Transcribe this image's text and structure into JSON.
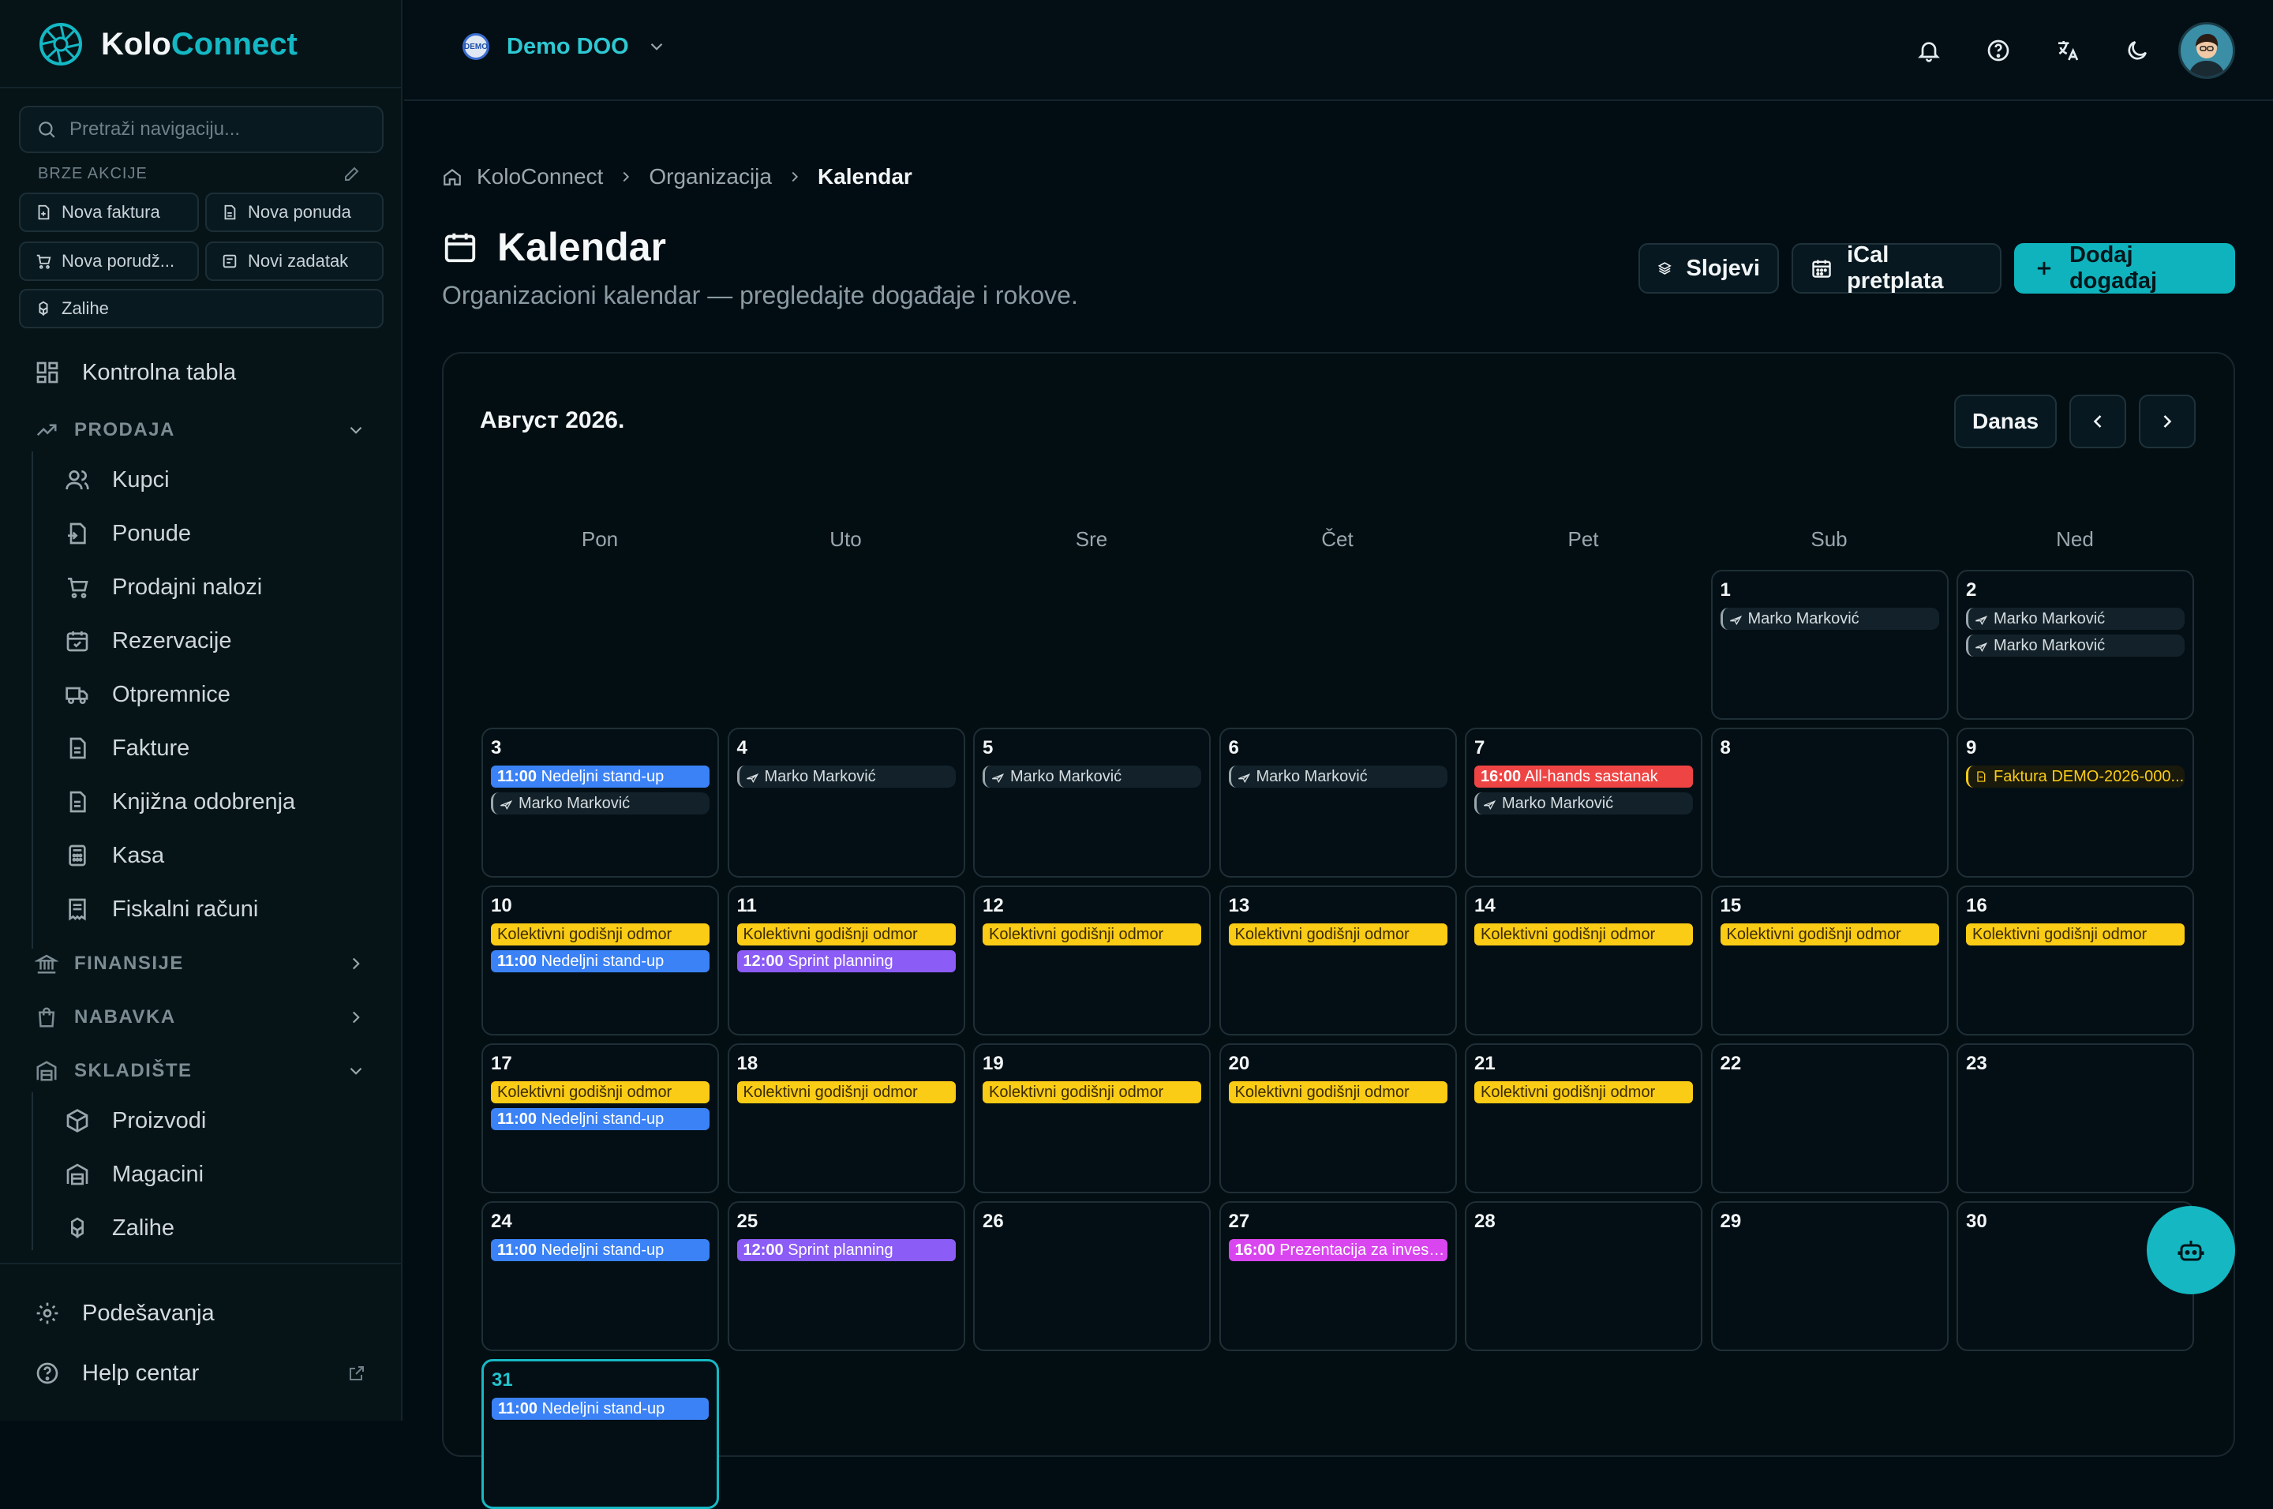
{
  "app": {
    "logo_first": "Kolo",
    "logo_second": "Connect"
  },
  "sidebar": {
    "search_placeholder": "Pretraži navigaciju...",
    "quick_actions_label": "BRZE AKCIJE",
    "quick_actions": [
      "Nova faktura",
      "Nova ponuda",
      "Nova porudž...",
      "Novi zadatak",
      "Zalihe"
    ],
    "dashboard": "Kontrolna tabla",
    "sections": {
      "prodaja": "PRODAJA",
      "finansije": "FINANSIJE",
      "nabavka": "NABAVKA",
      "skladiste": "SKLADIŠTE"
    },
    "prodaja_items": [
      "Kupci",
      "Ponude",
      "Prodajni nalozi",
      "Rezervacije",
      "Otpremnice",
      "Fakture",
      "Knjižna odobrenja",
      "Kasa",
      "Fiskalni računi"
    ],
    "skladiste_items": [
      "Proizvodi",
      "Magacini",
      "Zalihe"
    ],
    "settings": "Podešavanja",
    "help": "Help centar"
  },
  "topbar": {
    "org_badge": "DEMO",
    "org_name": "Demo DOO"
  },
  "breadcrumb": [
    "KoloConnect",
    "Organizacija",
    "Kalendar"
  ],
  "header": {
    "title": "Kalendar",
    "subtitle": "Organizacioni kalendar — pregledajte događaje i rokove.",
    "layers_btn": "Slojevi",
    "ical_btn": "iCal pretplata",
    "add_btn": "Dodaj događaj"
  },
  "calendar": {
    "month_label": "Август 2026.",
    "today_btn": "Danas",
    "weekdays": [
      "Pon",
      "Uto",
      "Sre",
      "Čet",
      "Pet",
      "Sub",
      "Ned"
    ],
    "days": [
      {
        "n": "1",
        "col": 5,
        "row": 0,
        "events": [
          {
            "t": "leave",
            "text": "Marko Marković"
          }
        ]
      },
      {
        "n": "2",
        "col": 6,
        "row": 0,
        "events": [
          {
            "t": "leave",
            "text": "Marko Marković"
          },
          {
            "t": "leave",
            "text": "Marko Marković"
          }
        ]
      },
      {
        "n": "3",
        "col": 0,
        "row": 1,
        "events": [
          {
            "t": "blue",
            "time": "11:00",
            "text": "Nedeljni stand-up"
          },
          {
            "t": "leave",
            "text": "Marko Marković"
          }
        ]
      },
      {
        "n": "4",
        "col": 1,
        "row": 1,
        "events": [
          {
            "t": "leave",
            "text": "Marko Marković"
          }
        ]
      },
      {
        "n": "5",
        "col": 2,
        "row": 1,
        "events": [
          {
            "t": "leave",
            "text": "Marko Marković"
          }
        ]
      },
      {
        "n": "6",
        "col": 3,
        "row": 1,
        "events": [
          {
            "t": "leave",
            "text": "Marko Marković"
          }
        ]
      },
      {
        "n": "7",
        "col": 4,
        "row": 1,
        "events": [
          {
            "t": "red",
            "time": "16:00",
            "text": "All-hands sastanak"
          },
          {
            "t": "leave",
            "text": "Marko Marković"
          }
        ]
      },
      {
        "n": "8",
        "col": 5,
        "row": 1,
        "events": []
      },
      {
        "n": "9",
        "col": 6,
        "row": 1,
        "events": [
          {
            "t": "invoice",
            "text": "Faktura DEMO-2026-000..."
          }
        ]
      },
      {
        "n": "10",
        "col": 0,
        "row": 2,
        "events": [
          {
            "t": "yellow",
            "text": "Kolektivni godišnji odmor"
          },
          {
            "t": "blue",
            "time": "11:00",
            "text": "Nedeljni stand-up"
          }
        ]
      },
      {
        "n": "11",
        "col": 1,
        "row": 2,
        "events": [
          {
            "t": "yellow",
            "text": "Kolektivni godišnji odmor"
          },
          {
            "t": "purple",
            "time": "12:00",
            "text": "Sprint planning"
          }
        ]
      },
      {
        "n": "12",
        "col": 2,
        "row": 2,
        "events": [
          {
            "t": "yellow",
            "text": "Kolektivni godišnji odmor"
          }
        ]
      },
      {
        "n": "13",
        "col": 3,
        "row": 2,
        "events": [
          {
            "t": "yellow",
            "text": "Kolektivni godišnji odmor"
          }
        ]
      },
      {
        "n": "14",
        "col": 4,
        "row": 2,
        "events": [
          {
            "t": "yellow",
            "text": "Kolektivni godišnji odmor"
          }
        ]
      },
      {
        "n": "15",
        "col": 5,
        "row": 2,
        "events": [
          {
            "t": "yellow",
            "text": "Kolektivni godišnji odmor"
          }
        ]
      },
      {
        "n": "16",
        "col": 6,
        "row": 2,
        "events": [
          {
            "t": "yellow",
            "text": "Kolektivni godišnji odmor"
          }
        ]
      },
      {
        "n": "17",
        "col": 0,
        "row": 3,
        "events": [
          {
            "t": "yellow",
            "text": "Kolektivni godišnji odmor"
          },
          {
            "t": "blue",
            "time": "11:00",
            "text": "Nedeljni stand-up"
          }
        ]
      },
      {
        "n": "18",
        "col": 1,
        "row": 3,
        "events": [
          {
            "t": "yellow",
            "text": "Kolektivni godišnji odmor"
          }
        ]
      },
      {
        "n": "19",
        "col": 2,
        "row": 3,
        "events": [
          {
            "t": "yellow",
            "text": "Kolektivni godišnji odmor"
          }
        ]
      },
      {
        "n": "20",
        "col": 3,
        "row": 3,
        "events": [
          {
            "t": "yellow",
            "text": "Kolektivni godišnji odmor"
          }
        ]
      },
      {
        "n": "21",
        "col": 4,
        "row": 3,
        "events": [
          {
            "t": "yellow",
            "text": "Kolektivni godišnji odmor"
          }
        ]
      },
      {
        "n": "22",
        "col": 5,
        "row": 3,
        "events": []
      },
      {
        "n": "23",
        "col": 6,
        "row": 3,
        "events": []
      },
      {
        "n": "24",
        "col": 0,
        "row": 4,
        "events": [
          {
            "t": "blue",
            "time": "11:00",
            "text": "Nedeljni stand-up"
          }
        ]
      },
      {
        "n": "25",
        "col": 1,
        "row": 4,
        "events": [
          {
            "t": "purple",
            "time": "12:00",
            "text": "Sprint planning"
          }
        ]
      },
      {
        "n": "26",
        "col": 2,
        "row": 4,
        "events": []
      },
      {
        "n": "27",
        "col": 3,
        "row": 4,
        "events": [
          {
            "t": "pink",
            "time": "16:00",
            "text": "Prezentacija za investit..."
          }
        ]
      },
      {
        "n": "28",
        "col": 4,
        "row": 4,
        "events": []
      },
      {
        "n": "29",
        "col": 5,
        "row": 4,
        "events": []
      },
      {
        "n": "30",
        "col": 6,
        "row": 4,
        "events": []
      },
      {
        "n": "31",
        "col": 0,
        "row": 5,
        "today": true,
        "events": [
          {
            "t": "blue",
            "time": "11:00",
            "text": "Nedeljni stand-up"
          }
        ]
      }
    ]
  },
  "colors": {
    "accent": "#14b8c4",
    "event_blue": "#3b82f6",
    "event_yellow": "#facc15",
    "event_red": "#ef4444",
    "event_purple": "#8b5cf6",
    "event_pink": "#d946ef"
  }
}
